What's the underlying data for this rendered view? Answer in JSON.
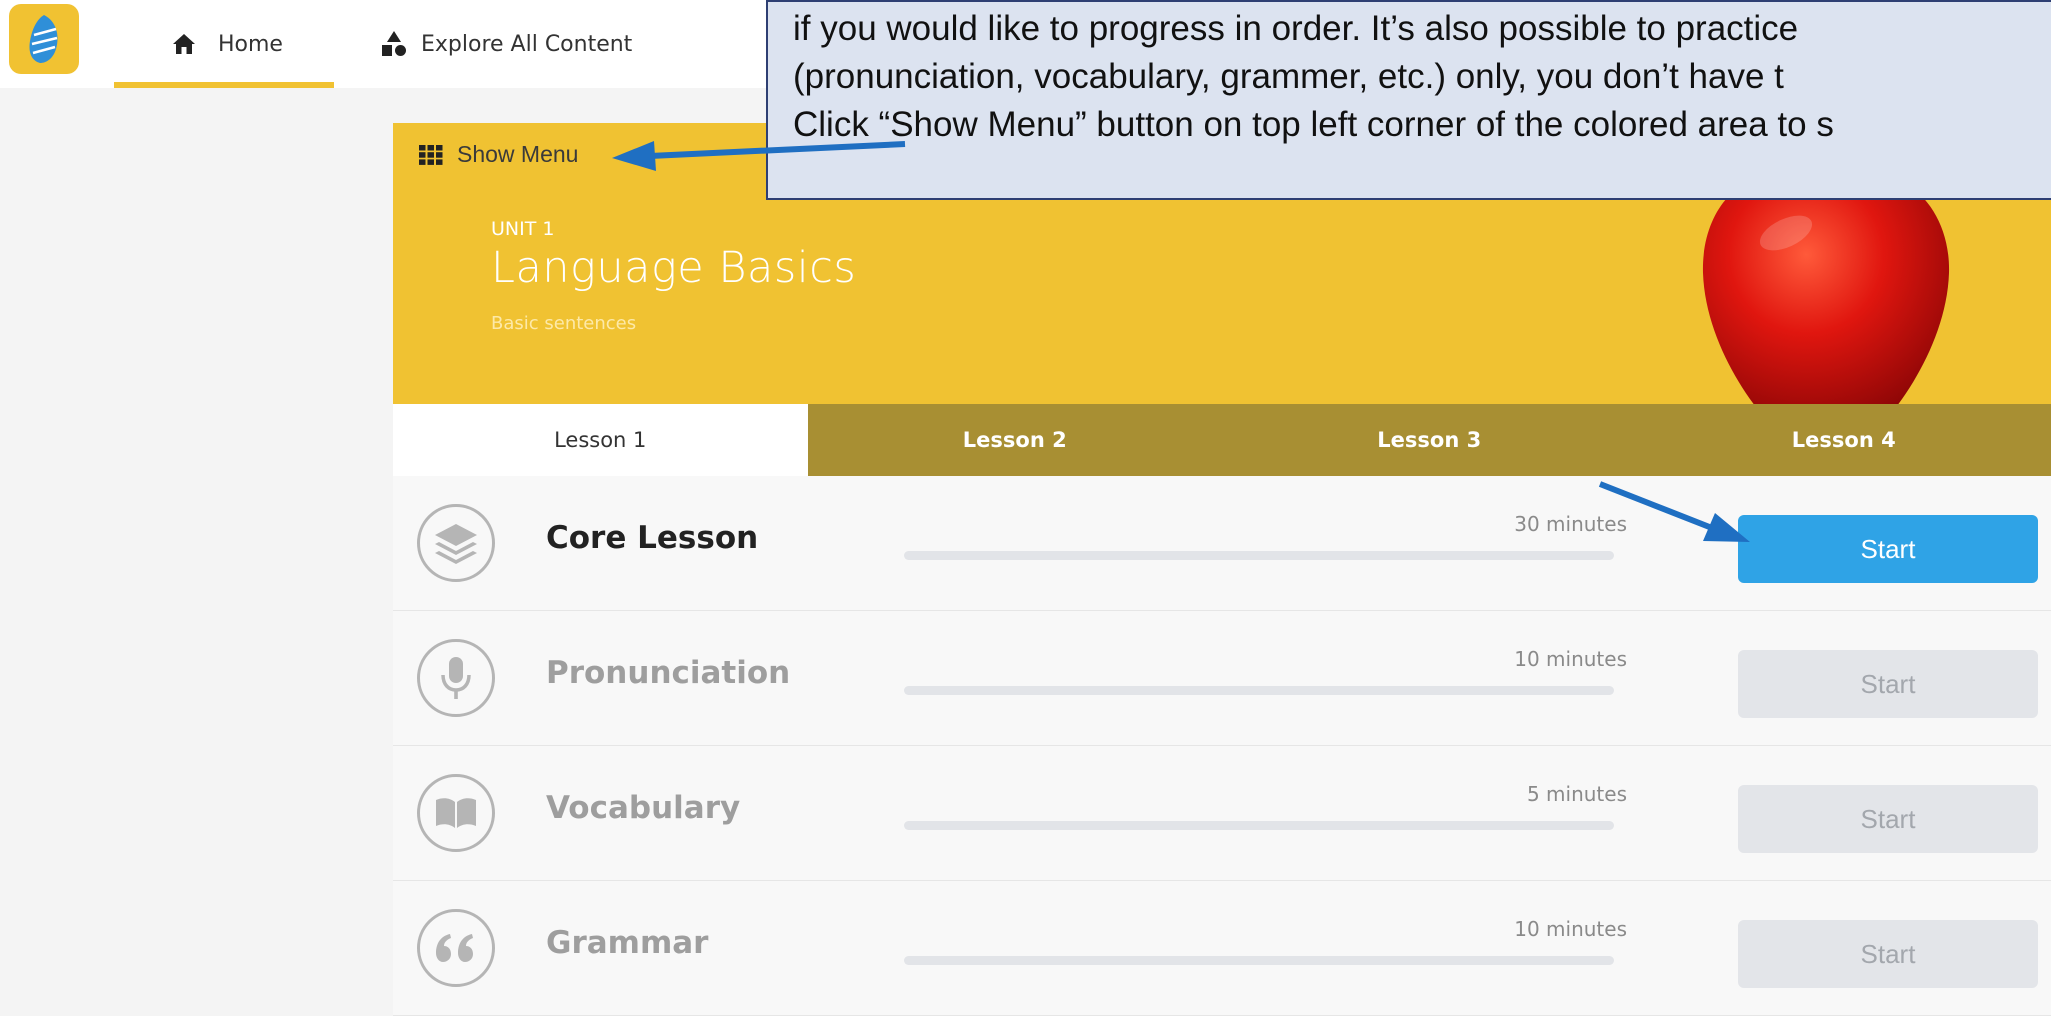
{
  "nav": {
    "home_label": "Home",
    "explore_label": "Explore All Content"
  },
  "hero": {
    "show_menu_label": "Show Menu",
    "unit_label": "UNIT 1",
    "unit_title": "Language Basics",
    "unit_subtitle": "Basic sentences"
  },
  "tabs": [
    "Lesson 1",
    "Lesson 2",
    "Lesson 3",
    "Lesson 4"
  ],
  "active_tab": "Lesson 1",
  "lessons": [
    {
      "name": "Core Lesson",
      "duration": "30 minutes",
      "button": "Start",
      "icon": "layers-icon",
      "progress": 0
    },
    {
      "name": "Pronunciation",
      "duration": "10 minutes",
      "button": "Start",
      "icon": "microphone-icon",
      "progress": 0
    },
    {
      "name": "Vocabulary",
      "duration": "5 minutes",
      "button": "Start",
      "icon": "book-icon",
      "progress": 0
    },
    {
      "name": "Grammar",
      "duration": "10 minutes",
      "button": "Start",
      "icon": "quote-icon",
      "progress": 0
    }
  ],
  "callout": {
    "line1": "if you would like to progress in order. It’s also possible to practice",
    "line2": "(pronunciation, vocabulary, grammer, etc.) only, you don’t have t",
    "line3": "Click “Show Menu” button on top left corner of the colored area to s"
  },
  "colors": {
    "brand_yellow": "#f0c232",
    "tab_gold": "#a88f33",
    "start_blue": "#2fa3e6",
    "arrow_blue": "#1f6fc2",
    "callout_bg": "#dce3f0",
    "callout_border": "#2e3f73"
  }
}
